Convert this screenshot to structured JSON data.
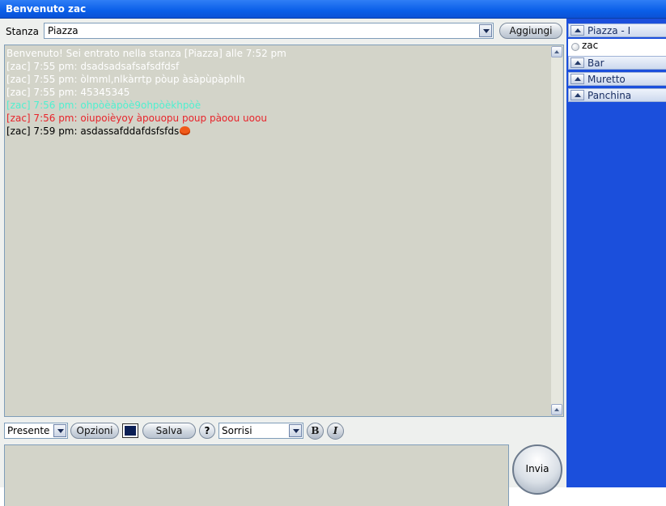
{
  "window": {
    "title": "Benvenuto zac"
  },
  "room_bar": {
    "label": "Stanza",
    "selected": "Piazza",
    "add_button": "Aggiungi"
  },
  "chat": {
    "messages": [
      {
        "text": "Benvenuto! Sei entrato nella stanza [Piazza] alle 7:52 pm",
        "color": "#ffffff"
      },
      {
        "text": "[zac] 7:55 pm: dsadsadsafsafsdfdsf",
        "color": "#ffffff"
      },
      {
        "text": "[zac] 7:55 pm: òlmml,nlkàrrtp pòup àsàpùpàphlh",
        "color": "#ffffff"
      },
      {
        "text": "[zac] 7:55 pm: 45345345",
        "color": "#ffffff"
      },
      {
        "text": "[zac] 7:56 pm: ohpòèàpòè9ohpòèkhpòè",
        "color": "#4ff0d0"
      },
      {
        "text": "[zac] 7:56 pm: oiupoièyoy   àpouopu poup pàoou   uoou",
        "color": "#e8242b"
      },
      {
        "text": "[zac] 7:59 pm: asdassafddafdsfsfds",
        "color": "#000000",
        "emoticon": "heart-emoticon"
      }
    ]
  },
  "toolbar": {
    "status": "Presente",
    "options_button": "Opzioni",
    "text_color": "#0b1f55",
    "save_button": "Salva",
    "help_button": "?",
    "smileys": "Sorrisi",
    "bold_button": "B",
    "italic_button": "I"
  },
  "send_button": "Invia",
  "sidebar": {
    "rooms": [
      {
        "name": "Piazza - I",
        "expanded": true,
        "users": [
          "zac"
        ]
      },
      {
        "name": "Bar"
      },
      {
        "name": "Muretto"
      },
      {
        "name": "Panchina"
      }
    ]
  }
}
